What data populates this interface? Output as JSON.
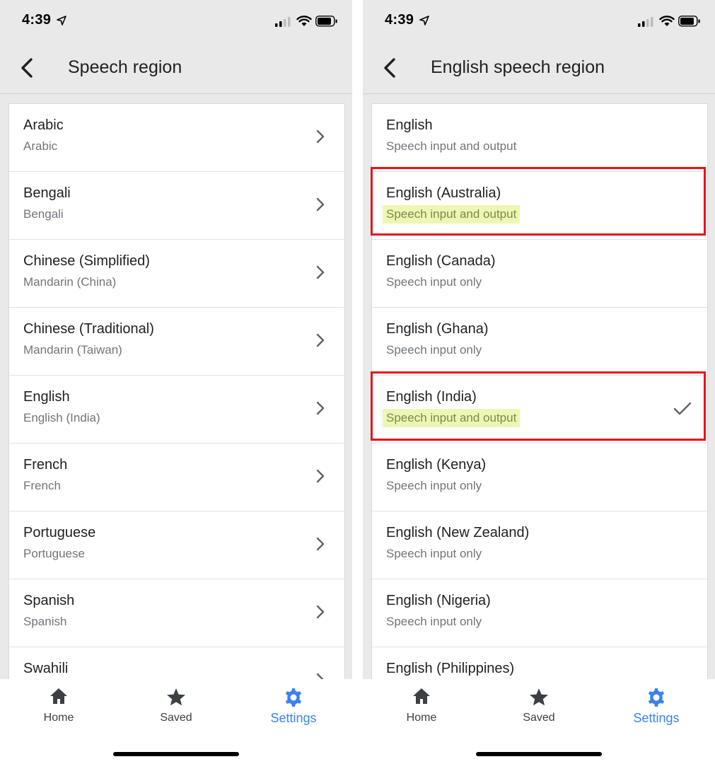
{
  "status_bar": {
    "time": "4:39"
  },
  "left_screen": {
    "title": "Speech region",
    "items": [
      {
        "primary": "Arabic",
        "secondary": "Arabic"
      },
      {
        "primary": "Bengali",
        "secondary": "Bengali"
      },
      {
        "primary": "Chinese (Simplified)",
        "secondary": "Mandarin (China)"
      },
      {
        "primary": "Chinese (Traditional)",
        "secondary": "Mandarin (Taiwan)"
      },
      {
        "primary": "English",
        "secondary": "English (India)"
      },
      {
        "primary": "French",
        "secondary": "French"
      },
      {
        "primary": "Portuguese",
        "secondary": "Portuguese"
      },
      {
        "primary": "Spanish",
        "secondary": "Spanish"
      },
      {
        "primary": "Swahili",
        "secondary": ""
      }
    ]
  },
  "right_screen": {
    "title": "English speech region",
    "selected_item": "English (India)",
    "items": [
      {
        "primary": "English",
        "secondary": "Speech input and output"
      },
      {
        "primary": "English (Australia)",
        "secondary": "Speech input and output"
      },
      {
        "primary": "English (Canada)",
        "secondary": "Speech input only"
      },
      {
        "primary": "English (Ghana)",
        "secondary": "Speech input only"
      },
      {
        "primary": "English (India)",
        "secondary": "Speech input and output"
      },
      {
        "primary": "English (Kenya)",
        "secondary": "Speech input only"
      },
      {
        "primary": "English (New Zealand)",
        "secondary": "Speech input only"
      },
      {
        "primary": "English (Nigeria)",
        "secondary": "Speech input only"
      },
      {
        "primary": "English (Philippines)",
        "secondary": ""
      }
    ]
  },
  "tab_bar": {
    "home": "Home",
    "saved": "Saved",
    "settings": "Settings",
    "active_tab": "Settings"
  },
  "colors": {
    "accent": "#3b82f0",
    "highlight_box": "#e8121b",
    "text_highlight": "#eef6b4"
  }
}
